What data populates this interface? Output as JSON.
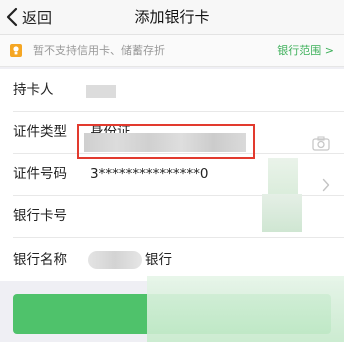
{
  "nav": {
    "back_label": "返回",
    "title": "添加银行卡"
  },
  "notice": {
    "text": "暂不支持信用卡、储蓄存折",
    "link": "银行范围 >"
  },
  "form": {
    "holder_label": "持卡人",
    "idtype_label": "证件类型",
    "idtype_value": "身份证",
    "idno_label": "证件号码",
    "idno_value": "3***************0",
    "cardno_label": "银行卡号",
    "bank_label": "银行名称",
    "bank_value": "银行"
  },
  "colors": {
    "accent": "#3db05a",
    "button": "#4fc26b",
    "highlight": "#e23a2e"
  },
  "icons": [
    "chevron-left-icon",
    "bulb-icon",
    "camera-icon",
    "chevron-right-icon"
  ]
}
